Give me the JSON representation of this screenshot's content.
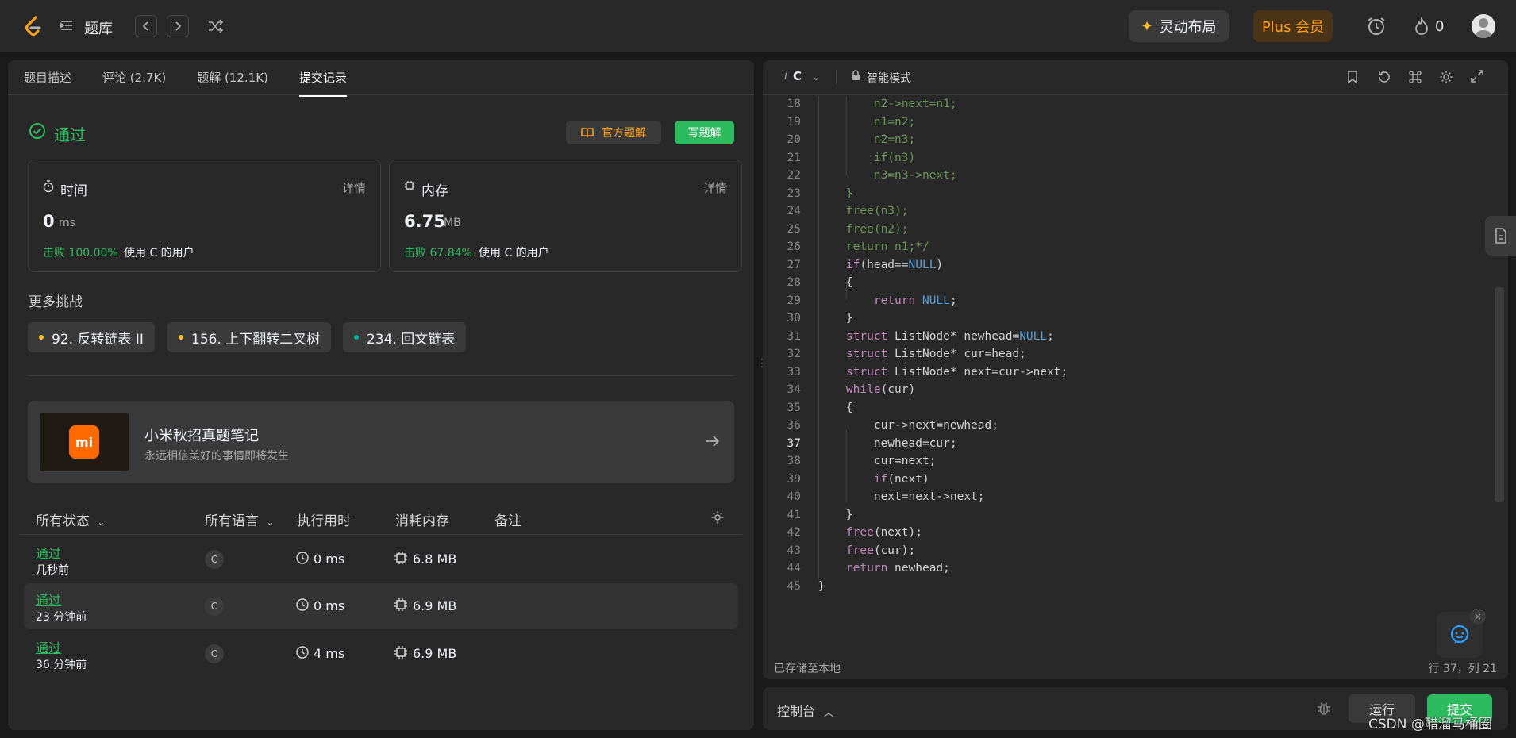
{
  "topbar": {
    "problem_bank": "题库",
    "dynamic_layout": "灵动布局",
    "plus": "Plus 会员",
    "streak": "0"
  },
  "left_tabs": [
    "题目描述",
    "评论 (2.7K)",
    "题解 (12.1K)",
    "提交记录"
  ],
  "result": {
    "status": "通过",
    "official_solution": "官方题解",
    "write_solution": "写题解"
  },
  "time_card": {
    "title": "时间",
    "detail": "详情",
    "value": "0",
    "unit": "ms",
    "beat": "击败 100.00%",
    "users": "使用 C 的用户"
  },
  "memory_card": {
    "title": "内存",
    "detail": "详情",
    "value": "6.75",
    "unit": "MB",
    "beat": "击败 67.84%",
    "users": "使用 C 的用户"
  },
  "challenges": {
    "title": "更多挑战",
    "items": [
      {
        "label": "92. 反转链表 II",
        "color": "#ffc01e"
      },
      {
        "label": "156. 上下翻转二叉树",
        "color": "#ffc01e"
      },
      {
        "label": "234. 回文链表",
        "color": "#00b8a3"
      }
    ]
  },
  "banner": {
    "title": "小米秋招真题笔记",
    "subtitle": "永远相信美好的事情即将发生"
  },
  "table": {
    "headers": {
      "status": "所有状态",
      "language": "所有语言",
      "runtime": "执行用时",
      "memory": "消耗内存",
      "note": "备注"
    },
    "rows": [
      {
        "status": "通过",
        "time": "几秒前",
        "lang": "C",
        "runtime": "0 ms",
        "memory": "6.8 MB"
      },
      {
        "status": "通过",
        "time": "23 分钟前",
        "lang": "C",
        "runtime": "0 ms",
        "memory": "6.9 MB"
      },
      {
        "status": "通过",
        "time": "36 分钟前",
        "lang": "C",
        "runtime": "4 ms",
        "memory": "6.9 MB"
      }
    ]
  },
  "editor": {
    "lang_indicator": "i",
    "language": "C",
    "mode": "智能模式",
    "saved": "已存储至本地",
    "cursor": "行 37，列 21"
  },
  "code_lines": [
    {
      "n": "18",
      "t": "        n2->next=n1;",
      "cls": "cm"
    },
    {
      "n": "19",
      "t": "        n1=n2;",
      "cls": "cm"
    },
    {
      "n": "20",
      "t": "        n2=n3;",
      "cls": "cm"
    },
    {
      "n": "21",
      "t": "        if(n3)",
      "cls": "cm"
    },
    {
      "n": "22",
      "t": "        n3=n3->next;",
      "cls": "cm"
    },
    {
      "n": "23",
      "t": "    }",
      "cls": "cm"
    },
    {
      "n": "24",
      "t": "    free(n3);",
      "cls": "cm"
    },
    {
      "n": "25",
      "t": "    free(n2);",
      "cls": "cm"
    },
    {
      "n": "26",
      "t": "    return n1;*/",
      "cls": "cm"
    },
    {
      "n": "27",
      "t": "    if(head==NULL)",
      "cls": ""
    },
    {
      "n": "28",
      "t": "    {",
      "cls": ""
    },
    {
      "n": "29",
      "t": "        return NULL;",
      "cls": ""
    },
    {
      "n": "30",
      "t": "    }",
      "cls": ""
    },
    {
      "n": "31",
      "t": "    struct ListNode* newhead=NULL;",
      "cls": ""
    },
    {
      "n": "32",
      "t": "    struct ListNode* cur=head;",
      "cls": ""
    },
    {
      "n": "33",
      "t": "    struct ListNode* next=cur->next;",
      "cls": ""
    },
    {
      "n": "34",
      "t": "    while(cur)",
      "cls": ""
    },
    {
      "n": "35",
      "t": "    {",
      "cls": ""
    },
    {
      "n": "36",
      "t": "        cur->next=newhead;",
      "cls": ""
    },
    {
      "n": "37",
      "t": "        newhead=cur;",
      "cls": ""
    },
    {
      "n": "38",
      "t": "        cur=next;",
      "cls": ""
    },
    {
      "n": "39",
      "t": "        if(next)",
      "cls": ""
    },
    {
      "n": "40",
      "t": "        next=next->next;",
      "cls": ""
    },
    {
      "n": "41",
      "t": "    }",
      "cls": ""
    },
    {
      "n": "42",
      "t": "    free(next);",
      "cls": ""
    },
    {
      "n": "43",
      "t": "    free(cur);",
      "cls": ""
    },
    {
      "n": "44",
      "t": "    return newhead;",
      "cls": ""
    },
    {
      "n": "45",
      "t": "}",
      "cls": ""
    }
  ],
  "console": {
    "label": "控制台",
    "run": "运行",
    "submit": "提交"
  },
  "watermark": "CSDN @醋溜马桶圈"
}
